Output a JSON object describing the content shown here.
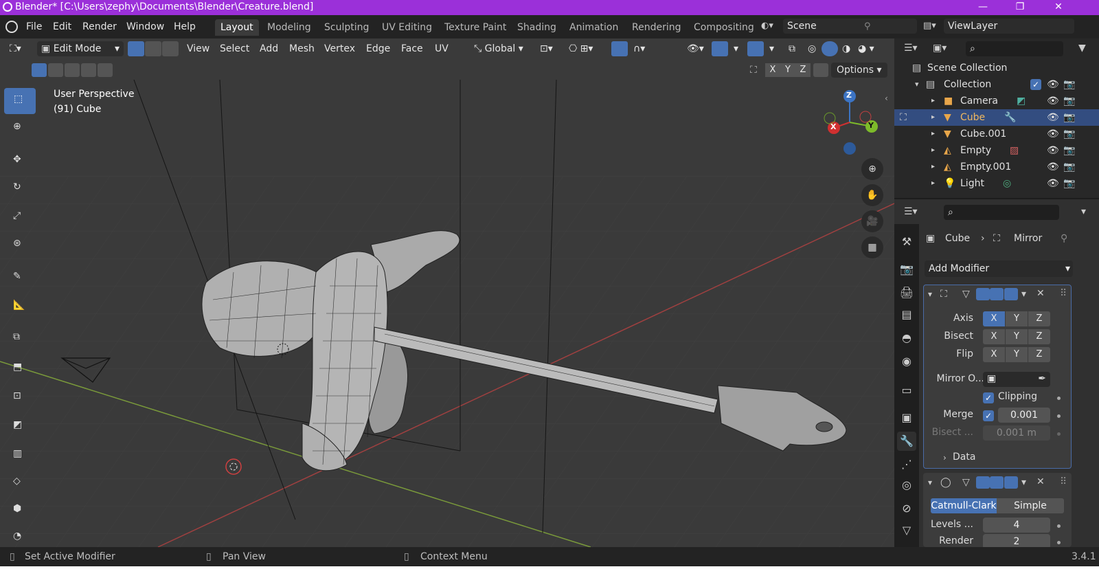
{
  "titlebar": {
    "title": "Blender* [C:\\Users\\zephy\\Documents\\Blender\\Creature.blend]",
    "minimize": "—",
    "maximize": "❐",
    "close": "✕"
  },
  "menu": {
    "file": "File",
    "edit": "Edit",
    "render": "Render",
    "window": "Window",
    "help": "Help"
  },
  "workspaces": [
    "Layout",
    "Modeling",
    "Sculpting",
    "UV Editing",
    "Texture Paint",
    "Shading",
    "Animation",
    "Rendering",
    "Compositing"
  ],
  "scene": {
    "name": "Scene",
    "viewlayer": "ViewLayer"
  },
  "viewport_header": {
    "mode": "Edit Mode",
    "view": "View",
    "select": "Select",
    "add": "Add",
    "mesh": "Mesh",
    "vertex": "Vertex",
    "edge": "Edge",
    "face": "Face",
    "uv": "UV",
    "orientation": "Global",
    "axis_x": "X",
    "axis_y": "Y",
    "axis_z": "Z",
    "options": "Options"
  },
  "overlay": {
    "perspective": "User Perspective",
    "object": "(91) Cube"
  },
  "gizmo": {
    "z": "Z",
    "x": "X",
    "y": "Y"
  },
  "outliner": {
    "scene_collection": "Scene Collection",
    "collection": "Collection",
    "items": [
      "Camera",
      "Cube",
      "Cube.001",
      "Empty",
      "Empty.001",
      "Light"
    ]
  },
  "properties": {
    "breadcrumb_object": "Cube",
    "breadcrumb_modifier": "Mirror",
    "add_modifier": "Add Modifier",
    "mirror": {
      "axis_label": "Axis",
      "bisect_label": "Bisect",
      "flip_label": "Flip",
      "x": "X",
      "y": "Y",
      "z": "Z",
      "mirror_object_label": "Mirror O...",
      "clipping_label": "Clipping",
      "merge_label": "Merge",
      "merge_value": "0.001",
      "bisect_dist_label": "Bisect ...",
      "bisect_dist_value": "0.001 m",
      "data_label": "Data"
    },
    "subsurf": {
      "catmull": "Catmull-Clark",
      "simple": "Simple",
      "levels_label": "Levels ...",
      "levels_value": "4",
      "render_label": "Render",
      "render_value": "2"
    }
  },
  "status": {
    "left": "Set Active Modifier",
    "middle": "Pan View",
    "right": "Context Menu",
    "version": "3.4.1"
  },
  "colors": {
    "title": "#9b30d9",
    "accent": "#4772b3",
    "selected_row": "#334d80",
    "object_orange": "#e8a64a"
  }
}
